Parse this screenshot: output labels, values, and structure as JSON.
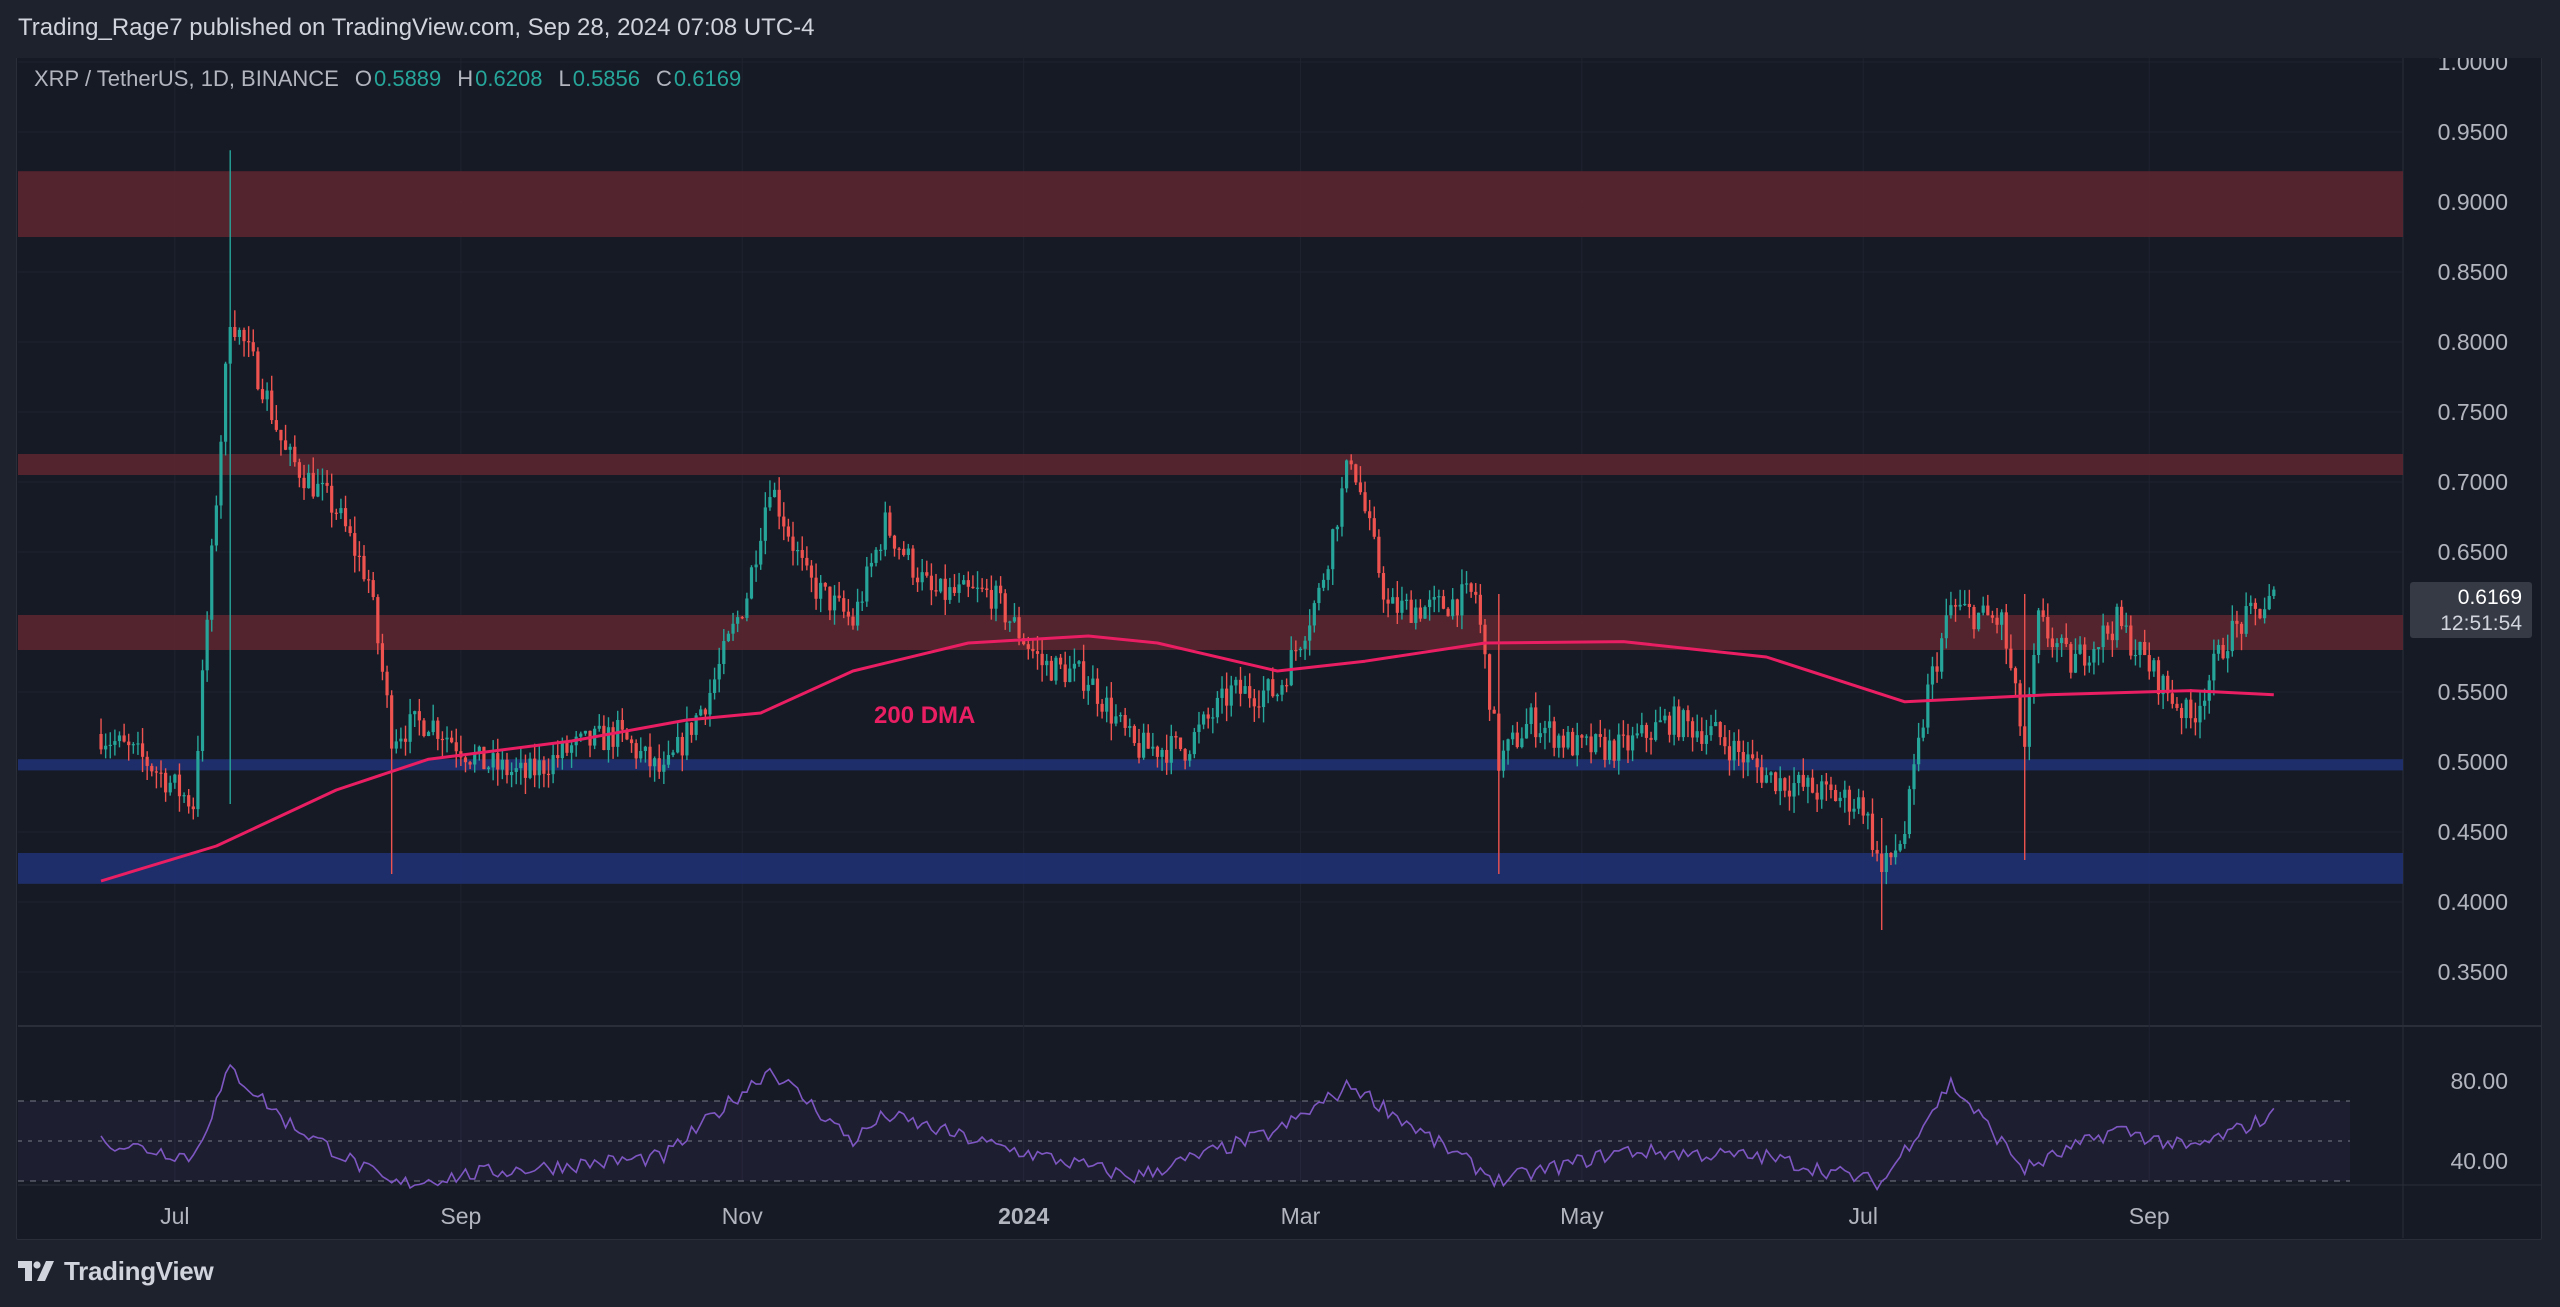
{
  "header": {
    "publisher": "Trading_Rage7 published on TradingView.com, Sep 28, 2024 07:08 UTC-4"
  },
  "legend": {
    "symbol": "XRP / TetherUS, 1D, BINANCE",
    "o_label": "O",
    "o_value": "0.5889",
    "h_label": "H",
    "h_value": "0.6208",
    "l_label": "L",
    "l_value": "0.5856",
    "c_label": "C",
    "c_value": "0.6169"
  },
  "price_tag": {
    "price": "0.6169",
    "countdown": "12:51:54"
  },
  "annotation": {
    "ma_label": "200 DMA"
  },
  "footer": {
    "brand": "TradingView"
  },
  "colors": {
    "up": "#26a69a",
    "down": "#ef5350",
    "ma": "#e91e63",
    "rsi": "#7e57c2",
    "resistance_zone": "#5a2530",
    "support_zone": "#1f3173",
    "background": "#161a25"
  },
  "chart_data": [
    {
      "type": "candlestick",
      "symbol": "XRP / TetherUS",
      "timeframe": "1D",
      "exchange": "BINANCE",
      "ylim": [
        0.3,
        1.0
      ],
      "y_ticks": [
        "1.0000",
        "0.9500",
        "0.9000",
        "0.8500",
        "0.8000",
        "0.7500",
        "0.7000",
        "0.6500",
        "0.6000",
        "0.5500",
        "0.5000",
        "0.4500",
        "0.4000",
        "0.3500"
      ],
      "x_ticks": [
        "Jul",
        "Sep",
        "Nov",
        "2024",
        "Mar",
        "May",
        "Jul",
        "Sep"
      ],
      "zones": [
        {
          "kind": "resistance",
          "from": 0.875,
          "to": 0.922
        },
        {
          "kind": "resistance",
          "from": 0.705,
          "to": 0.72
        },
        {
          "kind": "resistance",
          "from": 0.58,
          "to": 0.605
        },
        {
          "kind": "support",
          "from": 0.494,
          "to": 0.502
        },
        {
          "kind": "support",
          "from": 0.413,
          "to": 0.435
        }
      ],
      "price_path": [
        {
          "x": "2023-06-15",
          "y": 0.52
        },
        {
          "x": "2023-06-25",
          "y": 0.5
        },
        {
          "x": "2023-07-05",
          "y": 0.47
        },
        {
          "x": "2023-07-13",
          "y": 0.82
        },
        {
          "x": "2023-07-20",
          "y": 0.77
        },
        {
          "x": "2023-07-25",
          "y": 0.72
        },
        {
          "x": "2023-08-05",
          "y": 0.68
        },
        {
          "x": "2023-08-12",
          "y": 0.63
        },
        {
          "x": "2023-08-17",
          "y": 0.52
        },
        {
          "x": "2023-08-25",
          "y": 0.53
        },
        {
          "x": "2023-09-05",
          "y": 0.5
        },
        {
          "x": "2023-09-15",
          "y": 0.49
        },
        {
          "x": "2023-09-25",
          "y": 0.51
        },
        {
          "x": "2023-10-05",
          "y": 0.52
        },
        {
          "x": "2023-10-15",
          "y": 0.49
        },
        {
          "x": "2023-10-25",
          "y": 0.55
        },
        {
          "x": "2023-11-02",
          "y": 0.62
        },
        {
          "x": "2023-11-07",
          "y": 0.7
        },
        {
          "x": "2023-11-15",
          "y": 0.63
        },
        {
          "x": "2023-11-25",
          "y": 0.6
        },
        {
          "x": "2023-12-02",
          "y": 0.67
        },
        {
          "x": "2023-12-12",
          "y": 0.62
        },
        {
          "x": "2023-12-25",
          "y": 0.62
        },
        {
          "x": "2024-01-05",
          "y": 0.57
        },
        {
          "x": "2024-01-15",
          "y": 0.56
        },
        {
          "x": "2024-01-25",
          "y": 0.51
        },
        {
          "x": "2024-02-05",
          "y": 0.51
        },
        {
          "x": "2024-02-15",
          "y": 0.55
        },
        {
          "x": "2024-02-25",
          "y": 0.55
        },
        {
          "x": "2024-03-05",
          "y": 0.62
        },
        {
          "x": "2024-03-12",
          "y": 0.72
        },
        {
          "x": "2024-03-20",
          "y": 0.61
        },
        {
          "x": "2024-03-30",
          "y": 0.61
        },
        {
          "x": "2024-04-08",
          "y": 0.62
        },
        {
          "x": "2024-04-13",
          "y": 0.5
        },
        {
          "x": "2024-04-20",
          "y": 0.53
        },
        {
          "x": "2024-04-30",
          "y": 0.51
        },
        {
          "x": "2024-05-10",
          "y": 0.51
        },
        {
          "x": "2024-05-20",
          "y": 0.53
        },
        {
          "x": "2024-05-30",
          "y": 0.52
        },
        {
          "x": "2024-06-10",
          "y": 0.49
        },
        {
          "x": "2024-06-20",
          "y": 0.48
        },
        {
          "x": "2024-07-01",
          "y": 0.47
        },
        {
          "x": "2024-07-05",
          "y": 0.42
        },
        {
          "x": "2024-07-10",
          "y": 0.45
        },
        {
          "x": "2024-07-15",
          "y": 0.55
        },
        {
          "x": "2024-07-20",
          "y": 0.61
        },
        {
          "x": "2024-07-31",
          "y": 0.6
        },
        {
          "x": "2024-08-05",
          "y": 0.51
        },
        {
          "x": "2024-08-08",
          "y": 0.6
        },
        {
          "x": "2024-08-15",
          "y": 0.57
        },
        {
          "x": "2024-08-25",
          "y": 0.6
        },
        {
          "x": "2024-09-05",
          "y": 0.55
        },
        {
          "x": "2024-09-10",
          "y": 0.53
        },
        {
          "x": "2024-09-18",
          "y": 0.59
        },
        {
          "x": "2024-09-28",
          "y": 0.6169
        }
      ],
      "spike_events": [
        {
          "x": "2023-07-13",
          "high": 0.937,
          "low": 0.47
        },
        {
          "x": "2023-08-17",
          "high": 0.54,
          "low": 0.42
        },
        {
          "x": "2024-04-13",
          "high": 0.62,
          "low": 0.42
        },
        {
          "x": "2024-07-05",
          "high": 0.46,
          "low": 0.38
        },
        {
          "x": "2024-08-05",
          "high": 0.62,
          "low": 0.43
        }
      ],
      "ma_200": {
        "label": "200 DMA",
        "points": [
          {
            "x": "2023-06-15",
            "y": 0.415
          },
          {
            "x": "2023-07-10",
            "y": 0.44
          },
          {
            "x": "2023-08-05",
            "y": 0.48
          },
          {
            "x": "2023-08-25",
            "y": 0.502
          },
          {
            "x": "2023-09-25",
            "y": 0.515
          },
          {
            "x": "2023-10-20",
            "y": 0.53
          },
          {
            "x": "2023-11-05",
            "y": 0.535
          },
          {
            "x": "2023-11-25",
            "y": 0.565
          },
          {
            "x": "2023-12-20",
            "y": 0.585
          },
          {
            "x": "2024-01-15",
            "y": 0.59
          },
          {
            "x": "2024-01-30",
            "y": 0.585
          },
          {
            "x": "2024-02-25",
            "y": 0.565
          },
          {
            "x": "2024-03-15",
            "y": 0.572
          },
          {
            "x": "2024-04-10",
            "y": 0.585
          },
          {
            "x": "2024-05-10",
            "y": 0.586
          },
          {
            "x": "2024-06-10",
            "y": 0.575
          },
          {
            "x": "2024-07-10",
            "y": 0.543
          },
          {
            "x": "2024-08-10",
            "y": 0.548
          },
          {
            "x": "2024-09-10",
            "y": 0.551
          },
          {
            "x": "2024-09-28",
            "y": 0.548
          }
        ]
      }
    },
    {
      "type": "line",
      "name": "RSI",
      "ylim": [
        25,
        95
      ],
      "y_ticks": [
        "80.00",
        "40.00"
      ],
      "bands": [
        30,
        50,
        70
      ],
      "points": [
        {
          "x": "2023-06-15",
          "y": 50
        },
        {
          "x": "2023-07-05",
          "y": 42
        },
        {
          "x": "2023-07-13",
          "y": 86
        },
        {
          "x": "2023-07-25",
          "y": 60
        },
        {
          "x": "2023-08-17",
          "y": 28
        },
        {
          "x": "2023-09-05",
          "y": 34
        },
        {
          "x": "2023-10-15",
          "y": 42
        },
        {
          "x": "2023-11-07",
          "y": 86
        },
        {
          "x": "2023-11-25",
          "y": 50
        },
        {
          "x": "2023-12-02",
          "y": 63
        },
        {
          "x": "2023-12-25",
          "y": 48
        },
        {
          "x": "2024-01-25",
          "y": 32
        },
        {
          "x": "2024-02-25",
          "y": 55
        },
        {
          "x": "2024-03-12",
          "y": 78
        },
        {
          "x": "2024-03-30",
          "y": 50
        },
        {
          "x": "2024-04-13",
          "y": 30
        },
        {
          "x": "2024-05-10",
          "y": 45
        },
        {
          "x": "2024-06-10",
          "y": 42
        },
        {
          "x": "2024-07-05",
          "y": 29
        },
        {
          "x": "2024-07-20",
          "y": 79
        },
        {
          "x": "2024-08-05",
          "y": 36
        },
        {
          "x": "2024-08-25",
          "y": 56
        },
        {
          "x": "2024-09-10",
          "y": 46
        },
        {
          "x": "2024-09-28",
          "y": 63
        }
      ]
    }
  ]
}
